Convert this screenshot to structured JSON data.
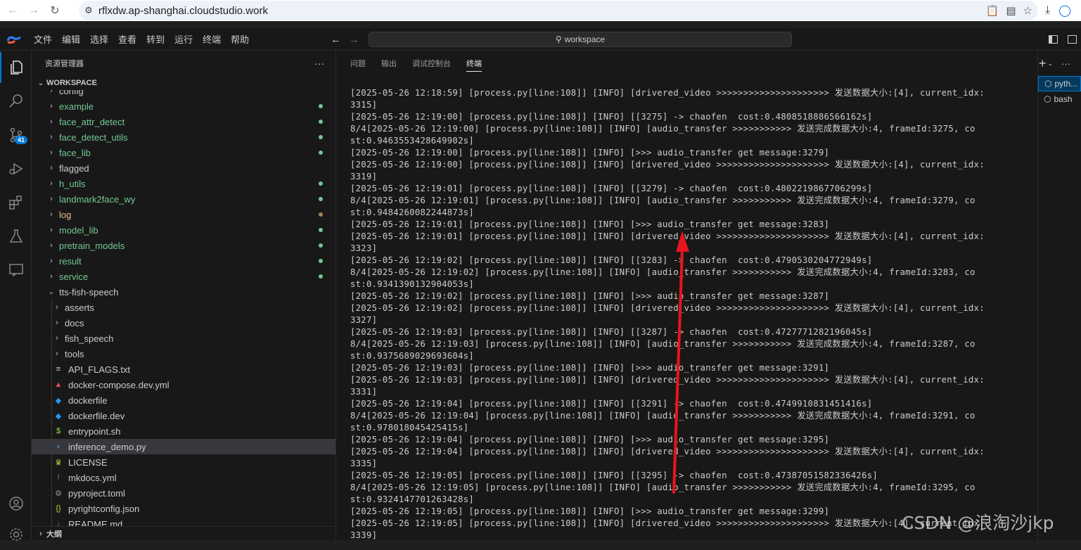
{
  "browser": {
    "url": "rflxdw.ap-shanghai.cloudstudio.work"
  },
  "menu": [
    "文件",
    "编辑",
    "选择",
    "查看",
    "转到",
    "运行",
    "终端",
    "帮助"
  ],
  "command_center": {
    "label": "workspace"
  },
  "activity_bar": {
    "scm_badge": "41"
  },
  "sidebar": {
    "title": "资源管理器",
    "more": "···",
    "workspace_label": "WORKSPACE",
    "outline_label": "大纲",
    "items": [
      {
        "label": "config",
        "kind": "folder",
        "depth": 0,
        "color": "#cccccc",
        "dot": ""
      },
      {
        "label": "example",
        "kind": "folder",
        "depth": 0,
        "color": "#73c991",
        "dot": "#73c991"
      },
      {
        "label": "face_attr_detect",
        "kind": "folder",
        "depth": 0,
        "color": "#73c991",
        "dot": "#73c991"
      },
      {
        "label": "face_detect_utils",
        "kind": "folder",
        "depth": 0,
        "color": "#73c991",
        "dot": "#73c991"
      },
      {
        "label": "face_lib",
        "kind": "folder",
        "depth": 0,
        "color": "#73c991",
        "dot": "#73c991"
      },
      {
        "label": "flagged",
        "kind": "folder",
        "depth": 0,
        "color": "#cccccc",
        "dot": ""
      },
      {
        "label": "h_utils",
        "kind": "folder",
        "depth": 0,
        "color": "#73c991",
        "dot": "#73c991"
      },
      {
        "label": "landmark2face_wy",
        "kind": "folder",
        "depth": 0,
        "color": "#73c991",
        "dot": "#73c991"
      },
      {
        "label": "log",
        "kind": "folder",
        "depth": 0,
        "color": "#e2c08d",
        "dot": "#a08655"
      },
      {
        "label": "model_lib",
        "kind": "folder",
        "depth": 0,
        "color": "#73c991",
        "dot": "#73c991"
      },
      {
        "label": "pretrain_models",
        "kind": "folder",
        "depth": 0,
        "color": "#73c991",
        "dot": "#73c991"
      },
      {
        "label": "result",
        "kind": "folder",
        "depth": 0,
        "color": "#73c991",
        "dot": "#73c991"
      },
      {
        "label": "service",
        "kind": "folder",
        "depth": 0,
        "color": "#73c991",
        "dot": "#73c991"
      },
      {
        "label": "tts-fish-speech",
        "kind": "folder-open",
        "depth": 0,
        "color": "#cccccc",
        "dot": ""
      },
      {
        "label": "asserts",
        "kind": "folder",
        "depth": 1,
        "color": "#cccccc",
        "dot": ""
      },
      {
        "label": "docs",
        "kind": "folder",
        "depth": 1,
        "color": "#cccccc",
        "dot": ""
      },
      {
        "label": "fish_speech",
        "kind": "folder",
        "depth": 1,
        "color": "#cccccc",
        "dot": ""
      },
      {
        "label": "tools",
        "kind": "folder",
        "depth": 1,
        "color": "#cccccc",
        "dot": ""
      },
      {
        "label": "API_FLAGS.txt",
        "kind": "txt",
        "depth": 1,
        "color": "#cccccc",
        "dot": ""
      },
      {
        "label": "docker-compose.dev.yml",
        "kind": "compose",
        "depth": 1,
        "color": "#cccccc",
        "dot": ""
      },
      {
        "label": "dockerfile",
        "kind": "docker",
        "depth": 1,
        "color": "#cccccc",
        "dot": ""
      },
      {
        "label": "dockerfile.dev",
        "kind": "docker",
        "depth": 1,
        "color": "#cccccc",
        "dot": ""
      },
      {
        "label": "entrypoint.sh",
        "kind": "shell",
        "depth": 1,
        "color": "#cccccc",
        "dot": ""
      },
      {
        "label": "inference_demo.py",
        "kind": "python",
        "depth": 1,
        "color": "#cccccc",
        "dot": "",
        "selected": true
      },
      {
        "label": "LICENSE",
        "kind": "license",
        "depth": 1,
        "color": "#cccccc",
        "dot": ""
      },
      {
        "label": "mkdocs.yml",
        "kind": "yml",
        "depth": 1,
        "color": "#cccccc",
        "dot": ""
      },
      {
        "label": "pyproject.toml",
        "kind": "toml",
        "depth": 1,
        "color": "#cccccc",
        "dot": ""
      },
      {
        "label": "pyrightconfig.json",
        "kind": "json",
        "depth": 1,
        "color": "#cccccc",
        "dot": ""
      },
      {
        "label": "README.md",
        "kind": "md",
        "depth": 1,
        "color": "#cccccc",
        "dot": ""
      }
    ]
  },
  "panel": {
    "tabs": [
      "问题",
      "输出",
      "调试控制台",
      "终端"
    ],
    "active_tab": 3,
    "terminal_lines": [
      "[2025-05-26 12:18:59] [process.py[line:108]] [INFO] [drivered_video >>>>>>>>>>>>>>>>>>>>> 发送数据大小:[4], current_idx:",
      "3315]",
      "[2025-05-26 12:19:00] [process.py[line:108]] [INFO] [[3275] -> chaofen  cost:0.4808518886566162s]",
      "8/4[2025-05-26 12:19:00] [process.py[line:108]] [INFO] [audio_transfer >>>>>>>>>>> 发送完成数据大小:4, frameId:3275, co",
      "st:0.9463553428649902s]",
      "[2025-05-26 12:19:00] [process.py[line:108]] [INFO] [>>> audio_transfer get message:3279]",
      "[2025-05-26 12:19:00] [process.py[line:108]] [INFO] [drivered_video >>>>>>>>>>>>>>>>>>>>> 发送数据大小:[4], current_idx:",
      "3319]",
      "[2025-05-26 12:19:01] [process.py[line:108]] [INFO] [[3279] -> chaofen  cost:0.4802219867706299s]",
      "8/4[2025-05-26 12:19:01] [process.py[line:108]] [INFO] [audio_transfer >>>>>>>>>>> 发送完成数据大小:4, frameId:3279, co",
      "st:0.9484260082244873s]",
      "[2025-05-26 12:19:01] [process.py[line:108]] [INFO] [>>> audio_transfer get message:3283]",
      "[2025-05-26 12:19:01] [process.py[line:108]] [INFO] [drivered_video >>>>>>>>>>>>>>>>>>>>> 发送数据大小:[4], current_idx:",
      "3323]",
      "[2025-05-26 12:19:02] [process.py[line:108]] [INFO] [[3283] -> chaofen  cost:0.4790530204772949s]",
      "8/4[2025-05-26 12:19:02] [process.py[line:108]] [INFO] [audio_transfer >>>>>>>>>>> 发送完成数据大小:4, frameId:3283, co",
      "st:0.9341390132904053s]",
      "[2025-05-26 12:19:02] [process.py[line:108]] [INFO] [>>> audio_transfer get message:3287]",
      "[2025-05-26 12:19:02] [process.py[line:108]] [INFO] [drivered_video >>>>>>>>>>>>>>>>>>>>> 发送数据大小:[4], current_idx:",
      "3327]",
      "[2025-05-26 12:19:03] [process.py[line:108]] [INFO] [[3287] -> chaofen  cost:0.4727771282196045s]",
      "8/4[2025-05-26 12:19:03] [process.py[line:108]] [INFO] [audio_transfer >>>>>>>>>>> 发送完成数据大小:4, frameId:3287, co",
      "st:0.9375689029693604s]",
      "[2025-05-26 12:19:03] [process.py[line:108]] [INFO] [>>> audio_transfer get message:3291]",
      "[2025-05-26 12:19:03] [process.py[line:108]] [INFO] [drivered_video >>>>>>>>>>>>>>>>>>>>> 发送数据大小:[4], current_idx:",
      "3331]",
      "[2025-05-26 12:19:04] [process.py[line:108]] [INFO] [[3291] -> chaofen  cost:0.4749910831451416s]",
      "8/4[2025-05-26 12:19:04] [process.py[line:108]] [INFO] [audio_transfer >>>>>>>>>>> 发送完成数据大小:4, frameId:3291, co",
      "st:0.978018045425415s]",
      "[2025-05-26 12:19:04] [process.py[line:108]] [INFO] [>>> audio_transfer get message:3295]",
      "[2025-05-26 12:19:04] [process.py[line:108]] [INFO] [drivered_video >>>>>>>>>>>>>>>>>>>>> 发送数据大小:[4], current_idx:",
      "3335]",
      "[2025-05-26 12:19:05] [process.py[line:108]] [INFO] [[3295] -> chaofen  cost:0.4738705158233642​6s]",
      "8/4[2025-05-26 12:19:05] [process.py[line:108]] [INFO] [audio_transfer >>>>>>>>>>> 发送完成数据大小:4, frameId:3295, co",
      "st:0.9324147701263428s]",
      "[2025-05-26 12:19:05] [process.py[line:108]] [INFO] [>>> audio_transfer get message:3299]",
      "[2025-05-26 12:19:05] [process.py[line:108]] [INFO] [drivered_video >>>>>>>>>>>>>>>>>>>>> 发送数据大小:[4], current_idx:",
      "3339]"
    ]
  },
  "terminal_list": {
    "items": [
      {
        "label": "pyth...",
        "active": true
      },
      {
        "label": "bash",
        "active": false
      }
    ]
  },
  "watermark": "CSDN @浪淘沙jkp",
  "annotation": {
    "color": "#e8141e"
  }
}
